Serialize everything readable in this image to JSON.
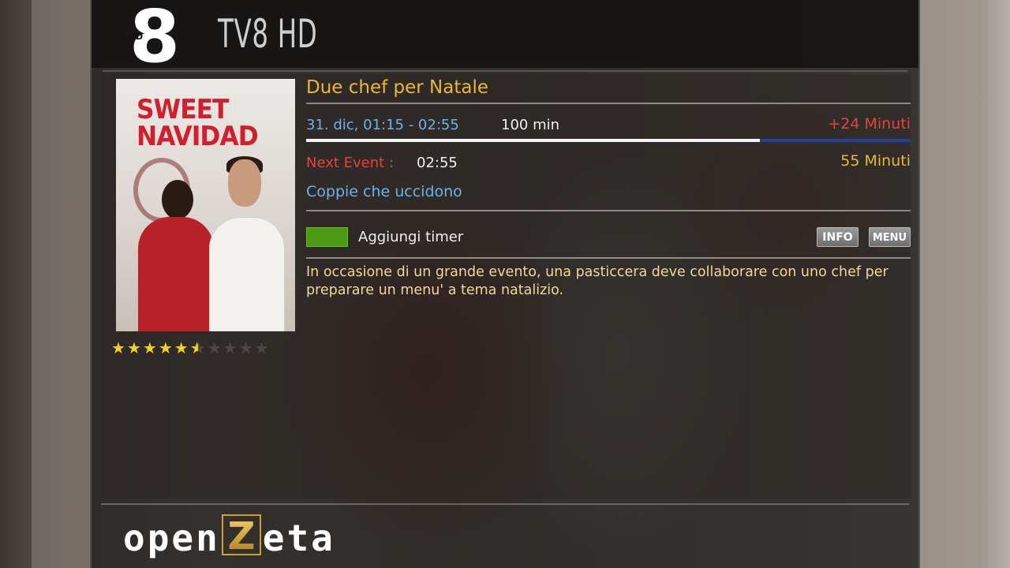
{
  "header": {
    "channel_logo_text": "8",
    "channel_logo_badge": "HD",
    "channel_name": "TV8 HD"
  },
  "event": {
    "title": "Due chef per Natale",
    "time_range": "31. dic, 01:15 - 02:55",
    "duration": "100 min",
    "elapsed": "+24 Minuti",
    "progress_percent": 75
  },
  "next_event": {
    "label": "Next Event :",
    "time": "02:55",
    "remaining": "55 Minuti",
    "title": "Coppie che uccidono"
  },
  "poster": {
    "title_line1": "SWEET",
    "title_line2": "NAVIDAD"
  },
  "rating": {
    "value": 5.5,
    "max": 10
  },
  "actions": {
    "timer_label": "Aggiungi timer",
    "timer_key_color": "#4c9a12",
    "info_label": "INFO",
    "menu_label": "MENU"
  },
  "description": "In occasione di un grande evento, una pasticcera deve collaborare con uno chef per preparare un menu' a tema natalizio.",
  "footer": {
    "brand_prefix": "open",
    "brand_z": "Z",
    "brand_suffix": "eta"
  },
  "colors": {
    "title": "#e9b73a",
    "time": "#6fb1e8",
    "alert": "#e4433a",
    "description": "#f0d79a",
    "progress_track": "#23439a"
  }
}
